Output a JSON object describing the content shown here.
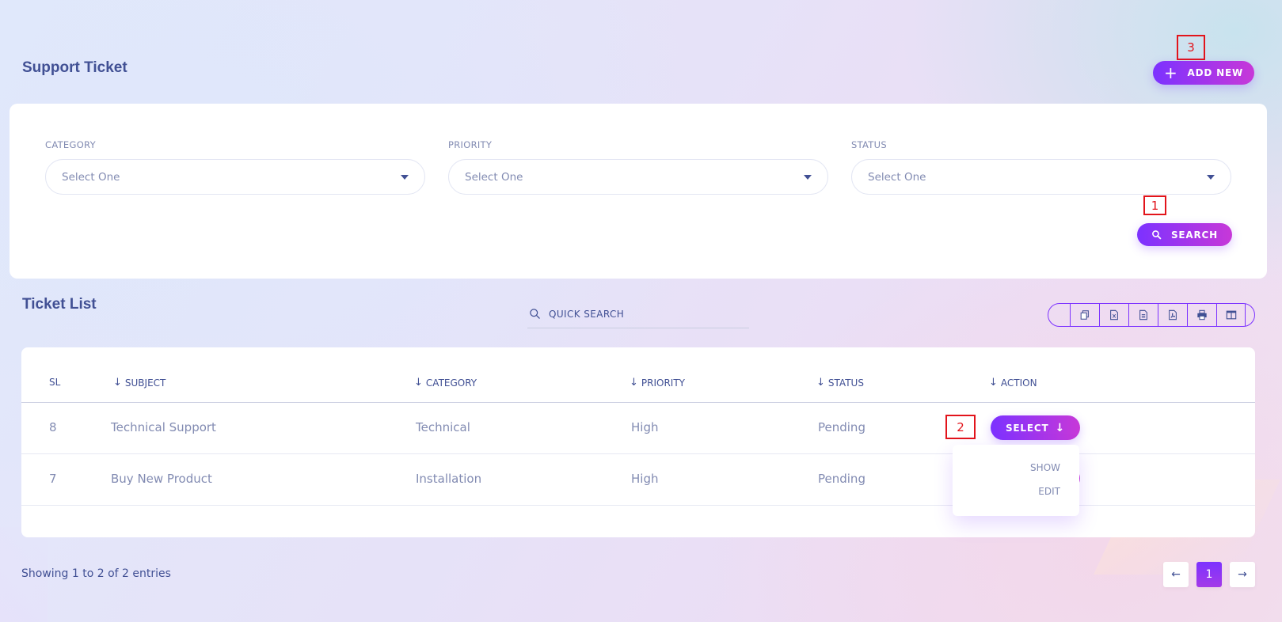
{
  "page": {
    "title": "Support Ticket"
  },
  "header": {
    "add_new_label": "ADD NEW",
    "plus_glyph": "+"
  },
  "filters": {
    "category": {
      "label": "CATEGORY",
      "value": "Select One"
    },
    "priority": {
      "label": "PRIORITY",
      "value": "Select One"
    },
    "status": {
      "label": "STATUS",
      "value": "Select One"
    },
    "search_label": "SEARCH"
  },
  "markers": {
    "m1": "1",
    "m2": "2",
    "m3": "3"
  },
  "ticket_list": {
    "title": "Ticket List",
    "quick_search_placeholder": "QUICK SEARCH",
    "export_icons": [
      "copy-icon",
      "excel-icon",
      "csv-icon",
      "pdf-icon",
      "print-icon",
      "column-visibility-icon"
    ],
    "columns": {
      "sl": "SL",
      "subject": "SUBJECT",
      "category": "CATEGORY",
      "priority": "PRIORITY",
      "status": "STATUS",
      "action": "ACTION"
    },
    "rows": [
      {
        "sl": "8",
        "subject": "Technical Support",
        "category": "Technical",
        "priority": "High",
        "status": "Pending"
      },
      {
        "sl": "7",
        "subject": "Buy New Product",
        "category": "Installation",
        "priority": "High",
        "status": "Pending"
      }
    ],
    "action_label": "SELECT",
    "dropdown": {
      "show": "SHOW",
      "edit": "EDIT"
    }
  },
  "footer": {
    "entries_text": "Showing 1 to 2 of 2 entries",
    "current_page": "1",
    "prev_glyph": "←",
    "next_glyph": "→"
  },
  "colors": {
    "accent_start": "#7c32ff",
    "accent_end": "#c738d8",
    "text_dark": "#415094",
    "text_muted": "#828bb2",
    "marker_red": "#e2141b"
  }
}
